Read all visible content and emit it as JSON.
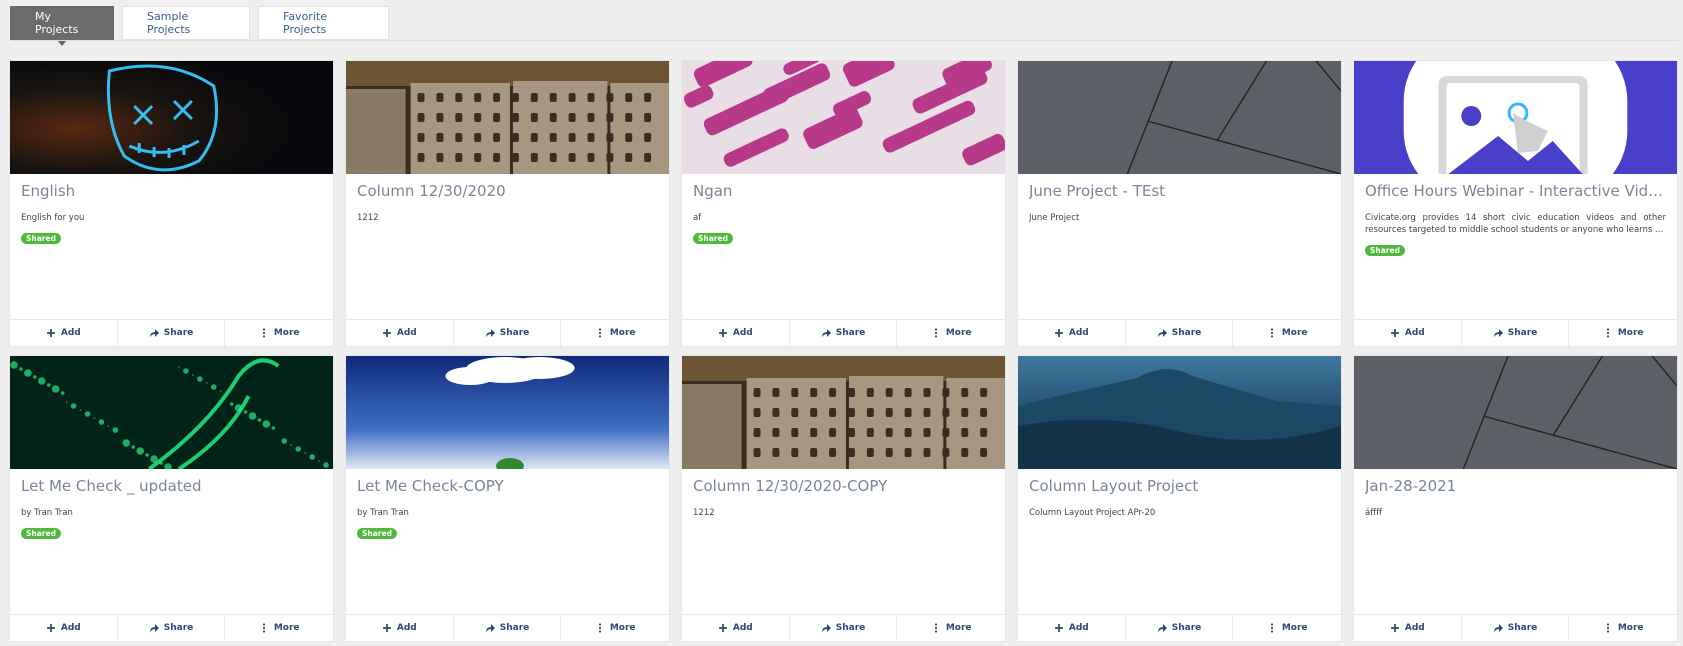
{
  "tabs": [
    {
      "label": "My Projects",
      "active": true
    },
    {
      "label": "Sample Projects",
      "active": false
    },
    {
      "label": "Favorite Projects",
      "active": false
    }
  ],
  "actions": {
    "add": "Add",
    "share": "Share",
    "more": "More"
  },
  "colors": {
    "active_tab": "#6b6b6b",
    "tab_text": "#3a5a90",
    "badge": "#4fb93a",
    "action_text": "#2f4a7a",
    "title_text": "#7a8597"
  },
  "projects": [
    {
      "title": "English",
      "description": "English for you",
      "badge": "Shared",
      "thumbnail": "neon-mask"
    },
    {
      "title": "Column 12/30/2020",
      "description": "1212",
      "badge": "",
      "thumbnail": "bricks"
    },
    {
      "title": "Ngan",
      "description": "af",
      "badge": "Shared",
      "thumbnail": "paint-strokes"
    },
    {
      "title": "June Project - TEst",
      "description": "June Project",
      "badge": "",
      "thumbnail": "grey-lines"
    },
    {
      "title": "Office Hours Webinar - Interactive Video",
      "description": "Civicate.org provides 14 short civic education videos and other resources targeted to middle school students or anyone who learns ...",
      "badge": "Shared",
      "thumbnail": "image-placeholder-icon"
    },
    {
      "title": "Let Me Check _ updated",
      "description": "by Tran Tran",
      "badge": "Shared",
      "thumbnail": "green-neon-particles"
    },
    {
      "title": "Let Me Check-COPY",
      "description": "by Tran Tran",
      "badge": "Shared",
      "thumbnail": "blue-sky-cloud"
    },
    {
      "title": "Column 12/30/2020-COPY",
      "description": "1212",
      "badge": "",
      "thumbnail": "bricks"
    },
    {
      "title": "Column Layout Project",
      "description": "Column Layout Project APr-20",
      "badge": "",
      "thumbnail": "misty-mountain"
    },
    {
      "title": "Jan-28-2021",
      "description": "áffff",
      "badge": "",
      "thumbnail": "grey-lines"
    }
  ]
}
